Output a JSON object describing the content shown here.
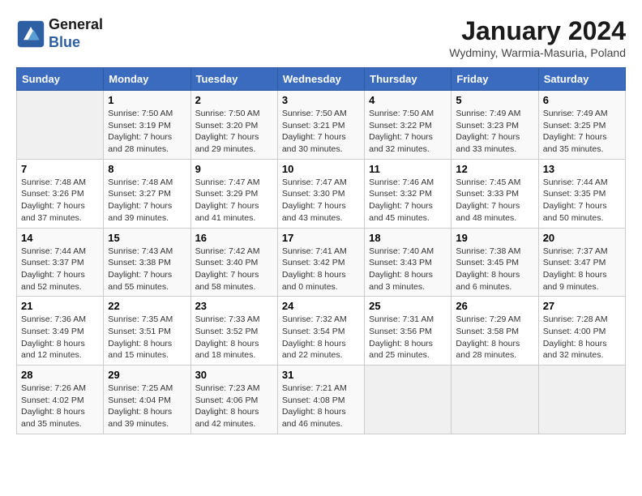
{
  "header": {
    "logo_line1": "General",
    "logo_line2": "Blue",
    "month": "January 2024",
    "location": "Wydminy, Warmia-Masuria, Poland"
  },
  "weekdays": [
    "Sunday",
    "Monday",
    "Tuesday",
    "Wednesday",
    "Thursday",
    "Friday",
    "Saturday"
  ],
  "weeks": [
    [
      {
        "day": "",
        "sunrise": "",
        "sunset": "",
        "daylight": ""
      },
      {
        "day": "1",
        "sunrise": "Sunrise: 7:50 AM",
        "sunset": "Sunset: 3:19 PM",
        "daylight": "Daylight: 7 hours and 28 minutes."
      },
      {
        "day": "2",
        "sunrise": "Sunrise: 7:50 AM",
        "sunset": "Sunset: 3:20 PM",
        "daylight": "Daylight: 7 hours and 29 minutes."
      },
      {
        "day": "3",
        "sunrise": "Sunrise: 7:50 AM",
        "sunset": "Sunset: 3:21 PM",
        "daylight": "Daylight: 7 hours and 30 minutes."
      },
      {
        "day": "4",
        "sunrise": "Sunrise: 7:50 AM",
        "sunset": "Sunset: 3:22 PM",
        "daylight": "Daylight: 7 hours and 32 minutes."
      },
      {
        "day": "5",
        "sunrise": "Sunrise: 7:49 AM",
        "sunset": "Sunset: 3:23 PM",
        "daylight": "Daylight: 7 hours and 33 minutes."
      },
      {
        "day": "6",
        "sunrise": "Sunrise: 7:49 AM",
        "sunset": "Sunset: 3:25 PM",
        "daylight": "Daylight: 7 hours and 35 minutes."
      }
    ],
    [
      {
        "day": "7",
        "sunrise": "Sunrise: 7:48 AM",
        "sunset": "Sunset: 3:26 PM",
        "daylight": "Daylight: 7 hours and 37 minutes."
      },
      {
        "day": "8",
        "sunrise": "Sunrise: 7:48 AM",
        "sunset": "Sunset: 3:27 PM",
        "daylight": "Daylight: 7 hours and 39 minutes."
      },
      {
        "day": "9",
        "sunrise": "Sunrise: 7:47 AM",
        "sunset": "Sunset: 3:29 PM",
        "daylight": "Daylight: 7 hours and 41 minutes."
      },
      {
        "day": "10",
        "sunrise": "Sunrise: 7:47 AM",
        "sunset": "Sunset: 3:30 PM",
        "daylight": "Daylight: 7 hours and 43 minutes."
      },
      {
        "day": "11",
        "sunrise": "Sunrise: 7:46 AM",
        "sunset": "Sunset: 3:32 PM",
        "daylight": "Daylight: 7 hours and 45 minutes."
      },
      {
        "day": "12",
        "sunrise": "Sunrise: 7:45 AM",
        "sunset": "Sunset: 3:33 PM",
        "daylight": "Daylight: 7 hours and 48 minutes."
      },
      {
        "day": "13",
        "sunrise": "Sunrise: 7:44 AM",
        "sunset": "Sunset: 3:35 PM",
        "daylight": "Daylight: 7 hours and 50 minutes."
      }
    ],
    [
      {
        "day": "14",
        "sunrise": "Sunrise: 7:44 AM",
        "sunset": "Sunset: 3:37 PM",
        "daylight": "Daylight: 7 hours and 52 minutes."
      },
      {
        "day": "15",
        "sunrise": "Sunrise: 7:43 AM",
        "sunset": "Sunset: 3:38 PM",
        "daylight": "Daylight: 7 hours and 55 minutes."
      },
      {
        "day": "16",
        "sunrise": "Sunrise: 7:42 AM",
        "sunset": "Sunset: 3:40 PM",
        "daylight": "Daylight: 7 hours and 58 minutes."
      },
      {
        "day": "17",
        "sunrise": "Sunrise: 7:41 AM",
        "sunset": "Sunset: 3:42 PM",
        "daylight": "Daylight: 8 hours and 0 minutes."
      },
      {
        "day": "18",
        "sunrise": "Sunrise: 7:40 AM",
        "sunset": "Sunset: 3:43 PM",
        "daylight": "Daylight: 8 hours and 3 minutes."
      },
      {
        "day": "19",
        "sunrise": "Sunrise: 7:38 AM",
        "sunset": "Sunset: 3:45 PM",
        "daylight": "Daylight: 8 hours and 6 minutes."
      },
      {
        "day": "20",
        "sunrise": "Sunrise: 7:37 AM",
        "sunset": "Sunset: 3:47 PM",
        "daylight": "Daylight: 8 hours and 9 minutes."
      }
    ],
    [
      {
        "day": "21",
        "sunrise": "Sunrise: 7:36 AM",
        "sunset": "Sunset: 3:49 PM",
        "daylight": "Daylight: 8 hours and 12 minutes."
      },
      {
        "day": "22",
        "sunrise": "Sunrise: 7:35 AM",
        "sunset": "Sunset: 3:51 PM",
        "daylight": "Daylight: 8 hours and 15 minutes."
      },
      {
        "day": "23",
        "sunrise": "Sunrise: 7:33 AM",
        "sunset": "Sunset: 3:52 PM",
        "daylight": "Daylight: 8 hours and 18 minutes."
      },
      {
        "day": "24",
        "sunrise": "Sunrise: 7:32 AM",
        "sunset": "Sunset: 3:54 PM",
        "daylight": "Daylight: 8 hours and 22 minutes."
      },
      {
        "day": "25",
        "sunrise": "Sunrise: 7:31 AM",
        "sunset": "Sunset: 3:56 PM",
        "daylight": "Daylight: 8 hours and 25 minutes."
      },
      {
        "day": "26",
        "sunrise": "Sunrise: 7:29 AM",
        "sunset": "Sunset: 3:58 PM",
        "daylight": "Daylight: 8 hours and 28 minutes."
      },
      {
        "day": "27",
        "sunrise": "Sunrise: 7:28 AM",
        "sunset": "Sunset: 4:00 PM",
        "daylight": "Daylight: 8 hours and 32 minutes."
      }
    ],
    [
      {
        "day": "28",
        "sunrise": "Sunrise: 7:26 AM",
        "sunset": "Sunset: 4:02 PM",
        "daylight": "Daylight: 8 hours and 35 minutes."
      },
      {
        "day": "29",
        "sunrise": "Sunrise: 7:25 AM",
        "sunset": "Sunset: 4:04 PM",
        "daylight": "Daylight: 8 hours and 39 minutes."
      },
      {
        "day": "30",
        "sunrise": "Sunrise: 7:23 AM",
        "sunset": "Sunset: 4:06 PM",
        "daylight": "Daylight: 8 hours and 42 minutes."
      },
      {
        "day": "31",
        "sunrise": "Sunrise: 7:21 AM",
        "sunset": "Sunset: 4:08 PM",
        "daylight": "Daylight: 8 hours and 46 minutes."
      },
      {
        "day": "",
        "sunrise": "",
        "sunset": "",
        "daylight": ""
      },
      {
        "day": "",
        "sunrise": "",
        "sunset": "",
        "daylight": ""
      },
      {
        "day": "",
        "sunrise": "",
        "sunset": "",
        "daylight": ""
      }
    ]
  ]
}
